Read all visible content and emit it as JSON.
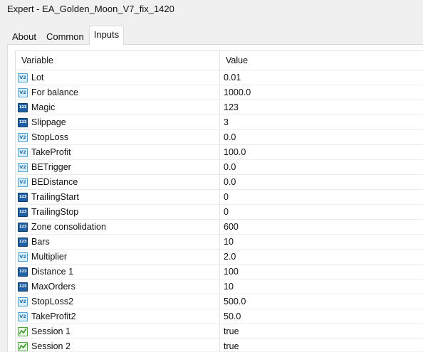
{
  "window": {
    "title": "Expert - EA_Golden_Moon_V7_fix_1420"
  },
  "tabs": [
    {
      "label": "About",
      "active": false
    },
    {
      "label": "Common",
      "active": false
    },
    {
      "label": "Inputs",
      "active": true
    }
  ],
  "table": {
    "columns": [
      "Variable",
      "Value"
    ],
    "rows": [
      {
        "icon": "v2",
        "variable": "Lot",
        "value": "0.01"
      },
      {
        "icon": "v2",
        "variable": "For balance",
        "value": "1000.0"
      },
      {
        "icon": "123",
        "variable": "Magic",
        "value": "123"
      },
      {
        "icon": "123",
        "variable": "Slippage",
        "value": "3"
      },
      {
        "icon": "v2",
        "variable": "StopLoss",
        "value": "0.0"
      },
      {
        "icon": "v2",
        "variable": "TakeProfit",
        "value": "100.0"
      },
      {
        "icon": "v2",
        "variable": "BETrigger",
        "value": "0.0"
      },
      {
        "icon": "v2",
        "variable": "BEDistance",
        "value": "0.0"
      },
      {
        "icon": "123",
        "variable": "TrailingStart",
        "value": "0"
      },
      {
        "icon": "123",
        "variable": "TrailingStop",
        "value": "0"
      },
      {
        "icon": "123",
        "variable": "Zone consolidation",
        "value": "600"
      },
      {
        "icon": "123",
        "variable": "Bars",
        "value": "10"
      },
      {
        "icon": "v2",
        "variable": "Multiplier",
        "value": "2.0"
      },
      {
        "icon": "123",
        "variable": "Distance 1",
        "value": "100"
      },
      {
        "icon": "123",
        "variable": "MaxOrders",
        "value": "10"
      },
      {
        "icon": "v2",
        "variable": "StopLoss2",
        "value": "500.0"
      },
      {
        "icon": "v2",
        "variable": "TakeProfit2",
        "value": "50.0"
      },
      {
        "icon": "session",
        "variable": "Session 1",
        "value": "true"
      },
      {
        "icon": "session",
        "variable": "Session 2",
        "value": "true"
      }
    ]
  },
  "icons": {
    "v2": {
      "name": "double-param-icon",
      "text": "V2",
      "color": "#4aa3d8"
    },
    "123": {
      "name": "integer-param-icon",
      "text": "123",
      "color": "#1f5fa3"
    },
    "session": {
      "name": "bool-param-icon",
      "color": "#52a640"
    }
  }
}
